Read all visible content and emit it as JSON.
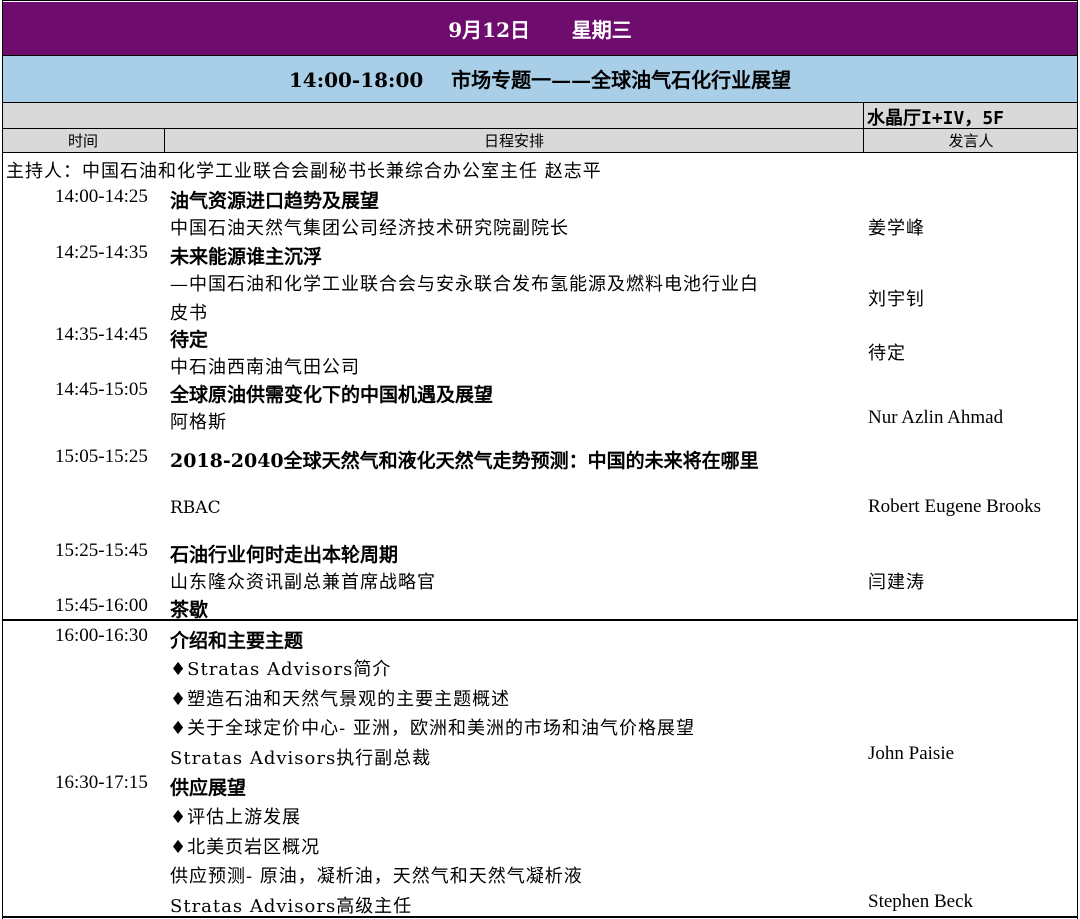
{
  "header": {
    "date": "9月12日      星期三",
    "session": "14:00-18:00    市场专题一——全球油气石化行业展望",
    "location": "水晶厅I+IV，5F"
  },
  "columns": {
    "time": "时间",
    "schedule": "日程安排",
    "speaker": "发言人"
  },
  "host": "主持人：中国石油和化学工业联合会副秘书长兼综合办公室主任 赵志平",
  "items": [
    {
      "time": "14:00-14:25",
      "title": "油气资源进口趋势及展望",
      "sub": [
        "中国石油天然气集团公司经济技术研究院副院长"
      ],
      "speaker": "姜学峰"
    },
    {
      "time": "14:25-14:35",
      "title": "未来能源谁主沉浮",
      "sub": [
        "—中国石油和化学工业联合会与安永联合发布氢能源及燃料电池行业白",
        "皮书"
      ],
      "speaker": "刘宇钊"
    },
    {
      "time": "14:35-14:45",
      "title": "待定",
      "sub": [
        "中石油西南油气田公司"
      ],
      "speaker": "待定"
    },
    {
      "time": "14:45-15:05",
      "title": "全球原油供需变化下的中国机遇及展望",
      "sub": [
        "阿格斯"
      ],
      "speaker": "Nur Azlin Ahmad"
    },
    {
      "time": "15:05-15:25",
      "title": "2018-2040全球天然气和液化天然气走势预测：中国的未来将在哪里",
      "sub": [
        "RBAC"
      ],
      "speaker": "Robert Eugene Brooks"
    },
    {
      "time": "15:25-15:45",
      "title": "石油行业何时走出本轮周期",
      "sub": [
        "山东隆众资讯副总兼首席战略官"
      ],
      "speaker": "闫建涛"
    },
    {
      "time": "15:45-16:00",
      "title": "茶歇",
      "sub": [],
      "speaker": ""
    },
    {
      "time": "16:00-16:30",
      "title": "介绍和主要主题",
      "sub": [
        "♦Stratas Advisors简介",
        "♦塑造石油和天然气景观的主要主题概述",
        "♦关于全球定价中心- 亚洲，欧洲和美洲的市场和油气价格展望",
        "Stratas Advisors执行副总裁"
      ],
      "speaker": "John Paisie"
    },
    {
      "time": "16:30-17:15",
      "title": "供应展望",
      "sub": [
        "♦评估上游发展",
        "♦北美页岩区概况",
        "供应预测- 原油，凝析油，天然气和天然气凝析液",
        "Stratas Advisors高级主任"
      ],
      "speaker": "Stephen Beck"
    }
  ]
}
